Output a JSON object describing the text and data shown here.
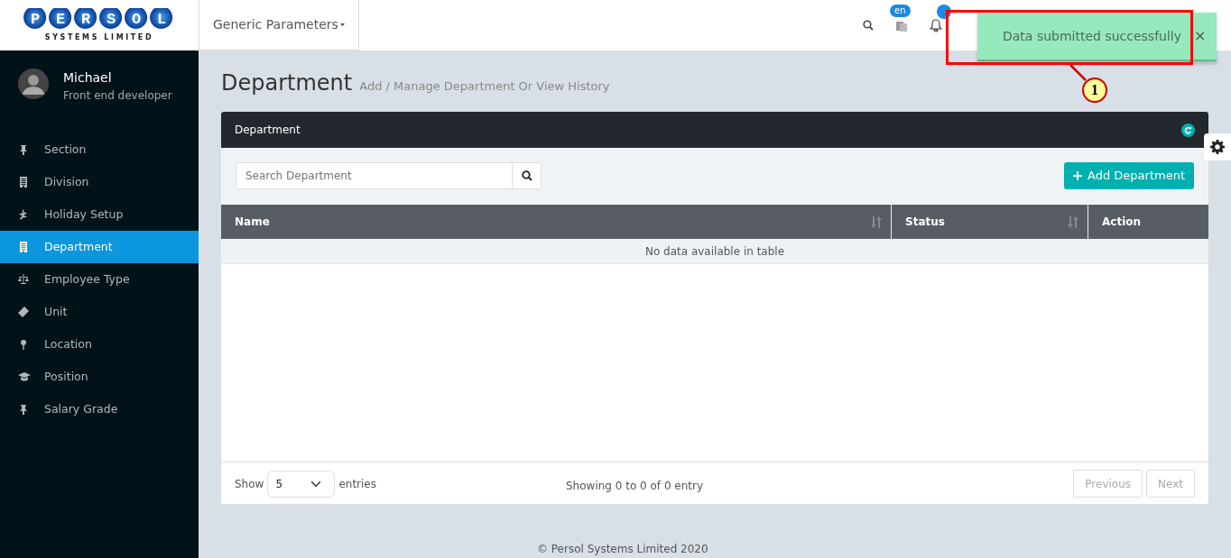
{
  "logo": {
    "letters": "PERSOL",
    "tagline": "SYSTEMS LIMITED"
  },
  "header": {
    "menu": "Generic Parameters",
    "language_badge": "en"
  },
  "user": {
    "name": "Michael",
    "role": "Front end developer"
  },
  "sidebar": {
    "items": [
      {
        "label": "Section",
        "selected": false
      },
      {
        "label": "Division",
        "selected": false
      },
      {
        "label": "Holiday Setup",
        "selected": false
      },
      {
        "label": "Department",
        "selected": true
      },
      {
        "label": "Employee Type",
        "selected": false
      },
      {
        "label": "Unit",
        "selected": false
      },
      {
        "label": "Location",
        "selected": false
      },
      {
        "label": "Position",
        "selected": false
      },
      {
        "label": "Salary Grade",
        "selected": false
      }
    ]
  },
  "page": {
    "title": "Department",
    "subtitle": "Add / Manage Department Or View History"
  },
  "card": {
    "title": "Department",
    "search": {
      "placeholder": "Search Department"
    },
    "add_button": "Add Department",
    "table": {
      "columns": [
        {
          "label": "Name",
          "sortable": true
        },
        {
          "label": "Status",
          "sortable": true
        },
        {
          "label": "Action",
          "sortable": false
        }
      ],
      "empty_message": "No data available in table"
    },
    "length": {
      "before": "Show",
      "value": "5",
      "after": "entries"
    },
    "info": "Showing 0 to 0 of 0 entry",
    "pagination": [
      {
        "label": "Previous",
        "disabled": true
      },
      {
        "label": "Next",
        "disabled": true
      }
    ]
  },
  "footer": "© Persol Systems Limited 2020",
  "toast": {
    "message": "Data submitted successfully",
    "close": "×"
  },
  "annotation": {
    "number": "1"
  }
}
